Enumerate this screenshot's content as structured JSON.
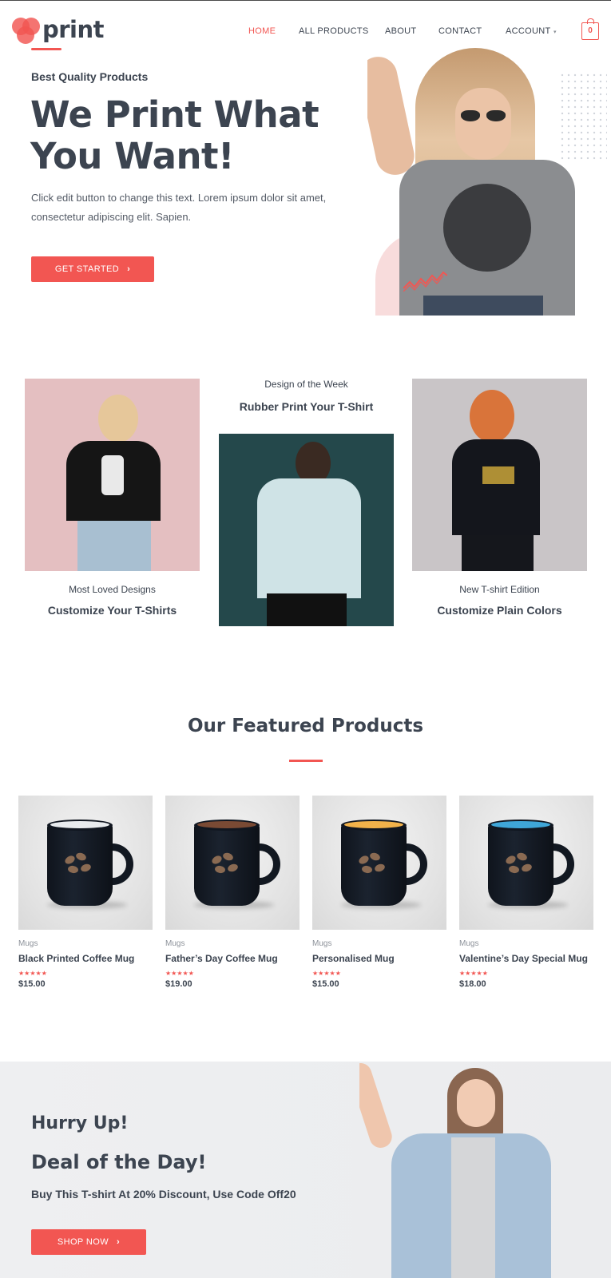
{
  "header": {
    "logo_text": "print",
    "nav": [
      {
        "label": "HOME",
        "active": true
      },
      {
        "label": "ALL PRODUCTS",
        "active": false
      },
      {
        "label": "ABOUT",
        "active": false
      },
      {
        "label": "CONTACT",
        "active": false
      },
      {
        "label": "ACCOUNT",
        "active": false
      }
    ],
    "cart_count": "0"
  },
  "hero": {
    "eyebrow": "Best Quality Products",
    "title": "We Print What You Want!",
    "text": "Click edit button to change this text. Lorem ipsum dolor sit amet, consectetur adipiscing elit. Sapien.",
    "button": "GET STARTED"
  },
  "designs": [
    {
      "small": "Most Loved Designs",
      "big": "Customize Your T-Shirts"
    },
    {
      "small": "Design of the Week",
      "big": "Rubber Print Your T-Shirt"
    },
    {
      "small": "New T-shirt Edition",
      "big": "Customize Plain Colors"
    }
  ],
  "featured": {
    "title": "Our Featured Products",
    "products": [
      {
        "category": "Mugs",
        "name": "Black Printed Coffee Mug",
        "price": "$15.00",
        "stars": "★★★★★",
        "inner_color": "#e8ebee"
      },
      {
        "category": "Mugs",
        "name": "Father’s Day Coffee Mug",
        "price": "$19.00",
        "stars": "★★★★★",
        "inner_color": "#7a4a34"
      },
      {
        "category": "Mugs",
        "name": "Personalised Mug",
        "price": "$15.00",
        "stars": "★★★★★",
        "inner_color": "#f2b24a"
      },
      {
        "category": "Mugs",
        "name": "Valentine’s Day Special Mug",
        "price": "$18.00",
        "stars": "★★★★★",
        "inner_color": "#3fa6d8"
      }
    ]
  },
  "deal": {
    "heading1": "Hurry Up!",
    "heading2": "Deal of the Day!",
    "text": "Buy This T-shirt At 20% Discount, Use Code Off20",
    "button": "SHOP NOW"
  },
  "colors": {
    "accent": "#f25652",
    "text": "#3c4450"
  }
}
